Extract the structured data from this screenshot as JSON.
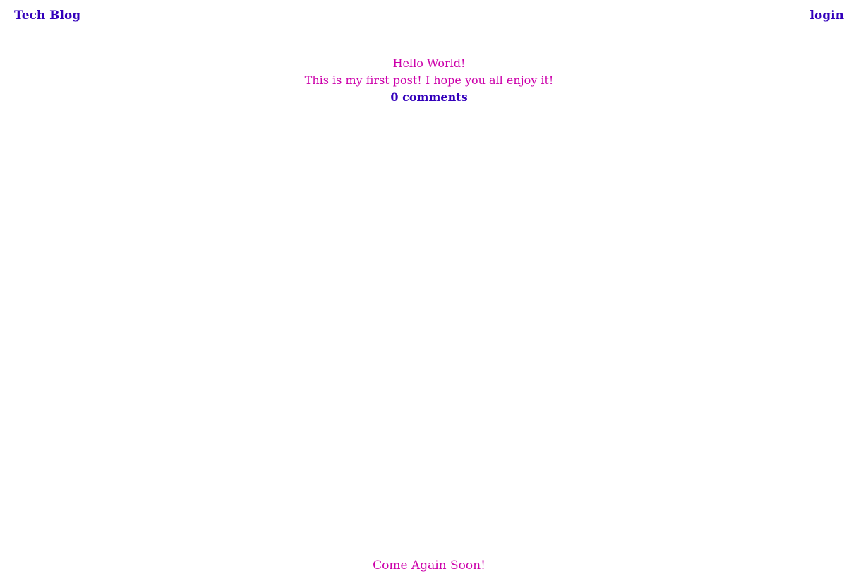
{
  "header": {
    "brand": "Tech Blog",
    "login_label": "login"
  },
  "post": {
    "title": "Hello World!",
    "body": "This is my first post! I hope you all enjoy it!",
    "comments_label": "0 comments"
  },
  "footer": {
    "message": "Come Again Soon!"
  },
  "colors": {
    "link": "#3300bb",
    "text": "#cc00aa",
    "rule": "#c8c8c8"
  }
}
